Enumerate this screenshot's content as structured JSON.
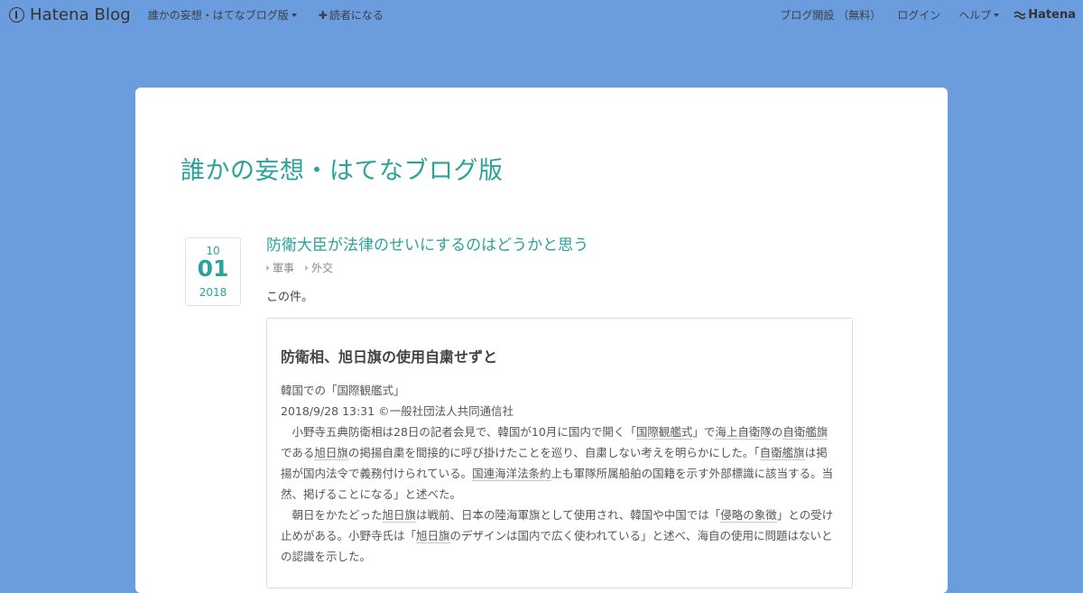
{
  "globalheader": {
    "brand": "Hatena Blog",
    "blog_menu": "誰かの妄想・はてなブログ版",
    "subscribe": "読者になる",
    "open_blog": "ブログ開設 （無料）",
    "login": "ログイン",
    "help": "ヘルプ",
    "hatena": "Hatena"
  },
  "blog": {
    "title": "誰かの妄想・はてなブログ版"
  },
  "entry": {
    "date": {
      "month": "10",
      "day": "01",
      "year": "2018"
    },
    "title": "防衛大臣が法律のせいにするのはどうかと思う",
    "categories": [
      "軍事",
      "外交"
    ],
    "intro": "この件。",
    "quote": {
      "heading": "防衛相、旭日旗の使用自粛せずと",
      "subtitle": "韓国での「国際観艦式」",
      "meta": "2018/9/28 13:31 ©一般社団法人共同通信社",
      "p1": [
        "小野寺五典防衛相は28日の記者会見で、韓国が10月に国内で開く「",
        "国際観艦式",
        "」で",
        "海上自衛隊",
        "の",
        "自衛艦旗",
        "である",
        "旭日旗",
        "の掲揚自粛を間接的に呼び掛けたことを巡り、自粛しない考えを明らかにした。「",
        "自衛艦旗",
        "は掲揚が国内法令で義務付けられている。",
        "国連海洋法条約",
        "上も軍隊所属船舶の国籍を示す外部標識に該当する。当然、掲げることになる」と述べた。"
      ],
      "p2": [
        "朝日をかたどった",
        "旭日旗",
        "は戦前、日本の陸海軍旗として使用され、韓国や中国では「",
        "侵略の象徴",
        "」との受け止めがある。小野寺氏は「",
        "旭日旗",
        "のデザインは国内で広く使われている」と述べ、海自の使用に問題はないとの認識を示した。"
      ]
    }
  }
}
